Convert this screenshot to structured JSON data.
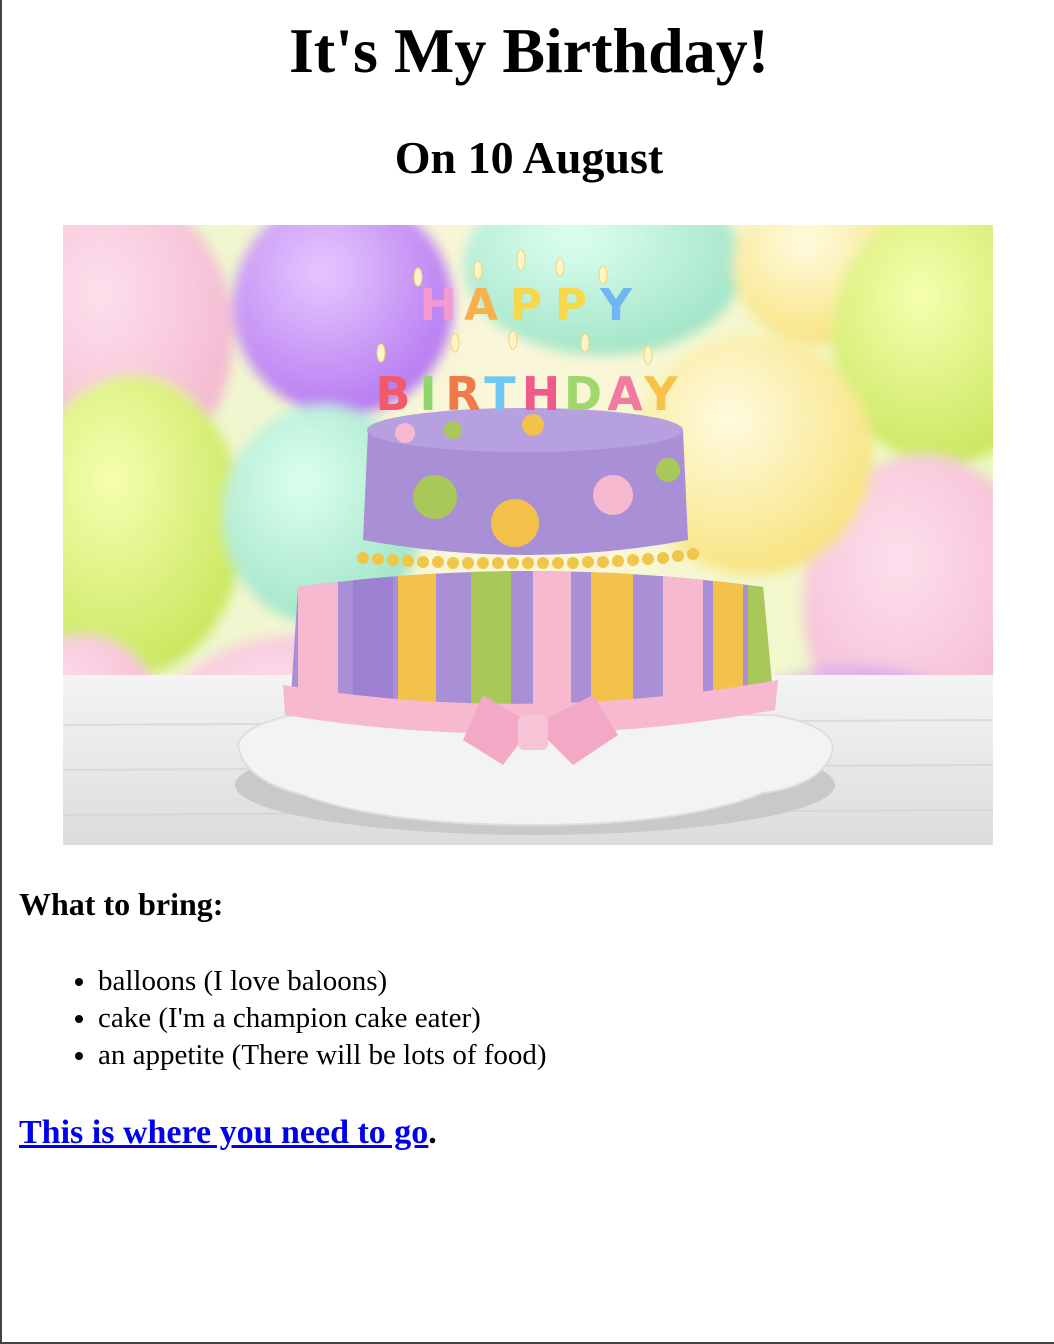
{
  "heading": "It's My Birthday!",
  "subheading": "On 10 August",
  "hero_image": {
    "name": "birthday-cake-image",
    "candle_letters_line1": "HAPPY",
    "candle_letters_line2": "BIRTHDAY",
    "colors": {
      "cake_purple": "#a98fd6",
      "stripe_yellow": "#f3c24a",
      "stripe_green": "#a8c85a",
      "ribbon_pink": "#f6b9cf",
      "plate": "#f2f2f2"
    }
  },
  "bring_section": {
    "title": "What to bring:",
    "items": [
      "balloons (I love baloons)",
      "cake (I'm a champion cake eater)",
      "an appetite (There will be lots of food)"
    ]
  },
  "directions": {
    "link_text": "This is where you need to go",
    "suffix": "."
  }
}
